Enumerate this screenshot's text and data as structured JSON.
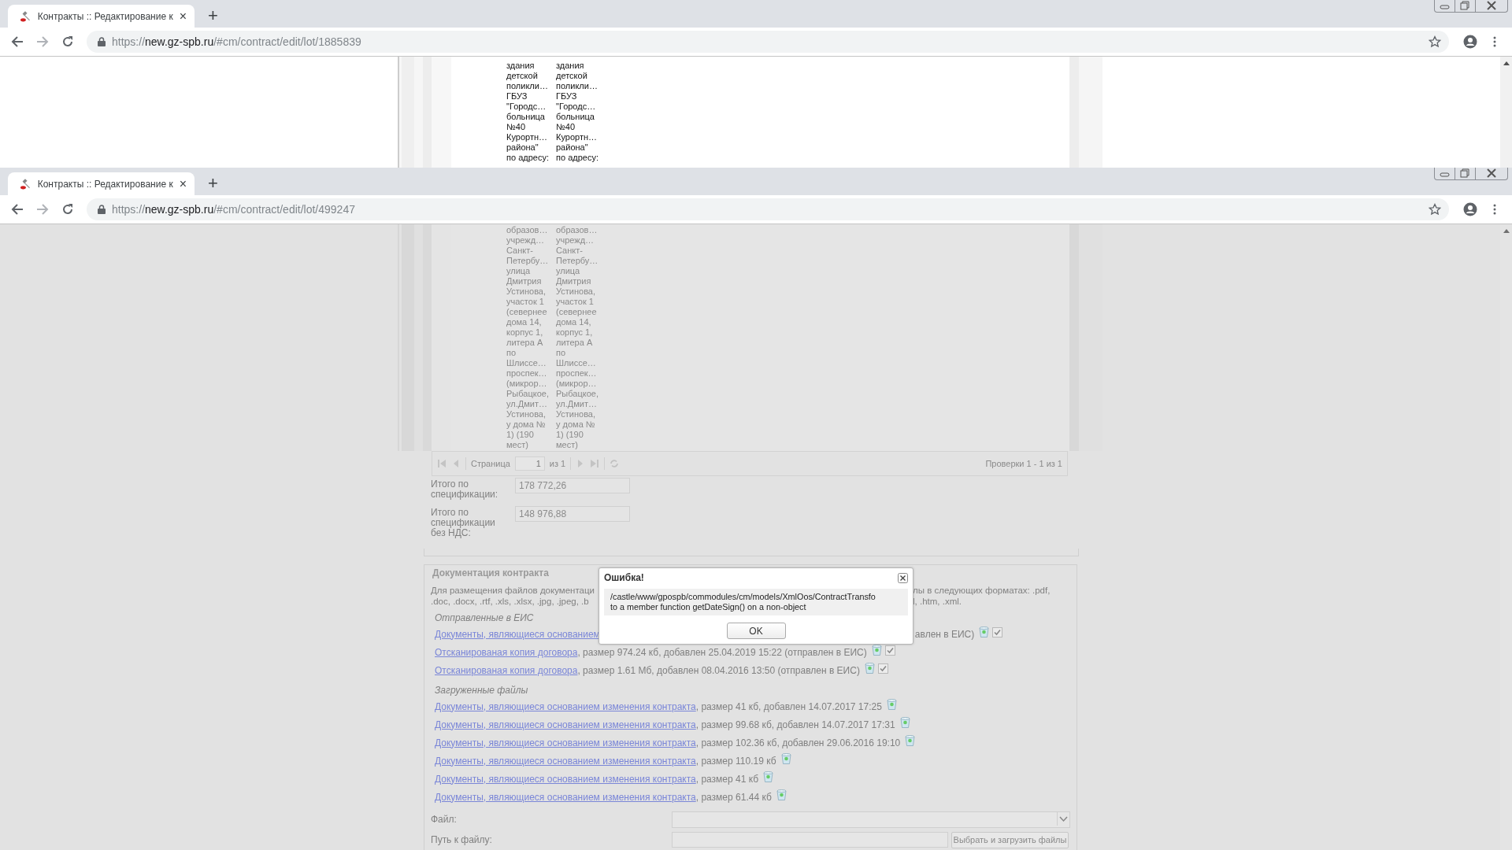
{
  "back_window": {
    "tab_title": "Контракты :: Редактирование к",
    "tab_close": "×",
    "new_tab": "+",
    "url_scheme": "https://",
    "url_host": "new.gz-spb.ru",
    "url_path": "/#cm/contract/edit/lot/1885839",
    "cells": [
      "здания\nдетской\nполикли…\nГБУЗ\n\"Городс…\nбольница\n№40\nКурортн…\nрайона\"\nпо адресу:",
      "здания\nдетской\nполикли…\nГБУЗ\n\"Городс…\nбольница\n№40\nКурортн…\nрайона\"\nпо адресу:"
    ]
  },
  "front_window": {
    "tab_title": "Контракты :: Редактирование к",
    "tab_close": "×",
    "new_tab": "+",
    "url_scheme": "https://",
    "url_host": "new.gz-spb.ru",
    "url_path": "/#cm/contract/edit/lot/499247",
    "cells": [
      "образов…\nучрежд…\nСанкт-\nПетербу…\nулица\nДмитрия\nУстинова,\nучасток 1\n(севернее\nдома 14,\nкорпус 1,\nлитера А\nпо\nШлиссе…\nпроспек…\n(микрор…\nРыбацкое,\nул.Дмит…\nУстинова,\nу дома №\n1) (190\nмест)",
      "образов…\nучрежд…\nСанкт-\nПетербу…\nулица\nДмитрия\nУстинова,\nучасток 1\n(севернее\nдома 14,\nкорпус 1,\nлитера А\nпо\nШлиссе…\nпроспек…\n(микрор…\nРыбацкое,\nул.Дмит…\nУстинова,\nу дома №\n1) (190\nмест)"
    ],
    "pager": {
      "page_label": "Страница",
      "page": "1",
      "of": "из 1",
      "summary": "Проверки 1 - 1 из 1"
    },
    "totals": [
      {
        "label": "Итого по спецификации:",
        "value": "178 772,26"
      },
      {
        "label": "Итого по спецификации без НДС:",
        "value": "148 976,88"
      }
    ],
    "documents": {
      "legend": "Документация контракта",
      "description_left": [
        "Для размещения файлов документаци",
        ".doc, .docx, .rtf, .xls, .xlsx, .jpg, .jpeg, .b"
      ],
      "description_right": [
        "лы в следующих форматах: .pdf,",
        "l, .htm, .xml."
      ],
      "sent_heading": "Отправленные в ЕИС",
      "sent_files": [
        {
          "kind": "split",
          "link": "Документы, являющиеся основанием",
          "details": "авлен в ЕИС)",
          "checked": true
        },
        {
          "kind": "plain",
          "link": "Отсканированая копия договора",
          "details": ", размер 974.24 кб, добавлен 25.04.2019 15:22 (отправлен в ЕИС)",
          "checked": true
        },
        {
          "kind": "plain",
          "link": "Отсканированая копия договора",
          "details": ", размер 1.61 Мб, добавлен 08.04.2016 13:50 (отправлен в ЕИС)",
          "checked": true
        }
      ],
      "uploaded_heading": "Загруженные файлы",
      "uploaded_files": [
        {
          "link": "Документы, являющиеся основанием изменения контракта",
          "details": ", размер 41 кб, добавлен 14.07.2017 17:25"
        },
        {
          "link": "Документы, являющиеся основанием изменения контракта",
          "details": ", размер 99.68 кб, добавлен 14.07.2017 17:31"
        },
        {
          "link": "Документы, являющиеся основанием изменения контракта",
          "details": ", размер 102.36 кб, добавлен 29.06.2016 19:10"
        },
        {
          "link": "Документы, являющиеся основанием изменения контракта",
          "details": ", размер 110.19 кб"
        },
        {
          "link": "Документы, являющиеся основанием изменения контракта",
          "details": ", размер 41 кб"
        },
        {
          "link": "Документы, являющиеся основанием изменения контракта",
          "details": ", размер 61.44 кб"
        }
      ],
      "file_label": "Файл:",
      "path_label": "Путь к файлу:",
      "upload_button": "Выбрать и загрузить файлы"
    },
    "dialog": {
      "title": "Ошибка!",
      "message": [
        "/castle/www/gpospb/commodules/cm/models/XmlOos/ContractTransfo",
        "to a member function getDateSign() on a non-object"
      ],
      "button": "OK"
    }
  }
}
